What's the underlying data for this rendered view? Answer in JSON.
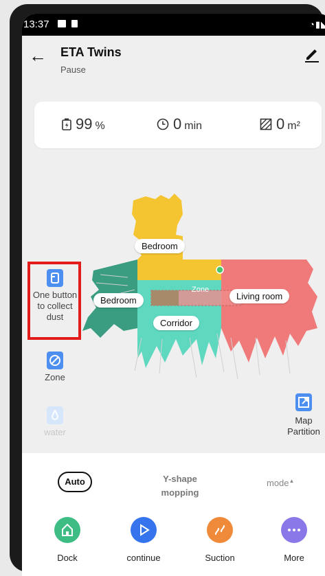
{
  "status_bar": {
    "time": "13:37"
  },
  "header": {
    "title": "ETA Twins",
    "subtitle": "Pause"
  },
  "stats": {
    "battery": {
      "value": "99",
      "unit": "%"
    },
    "time": {
      "value": "0",
      "unit": "min"
    },
    "area": {
      "value": "0",
      "unit": "m²"
    }
  },
  "map": {
    "labels": {
      "bedroom_top": "Bedroom",
      "bedroom_left": "Bedroom",
      "zone": "Zone",
      "living_room": "Living room",
      "corridor": "Corridor"
    },
    "colors": {
      "yellow": "#f5c431",
      "teal": "#3a9c80",
      "mint": "#5fd8c0",
      "coral": "#f07a7a",
      "zone_box": "#a78a6a"
    }
  },
  "side_actions": {
    "collect_dust": "One button to collect dust",
    "zone": "Zone",
    "water": "water"
  },
  "map_partition": "Map Partition",
  "modes": {
    "auto": "Auto",
    "yshape": "Y-shape mopping",
    "mode": "mode"
  },
  "actions": {
    "dock": {
      "label": "Dock",
      "color": "#3dbd84"
    },
    "continue": {
      "label": "continue",
      "color": "#3574ec"
    },
    "suction": {
      "label": "Suction",
      "color": "#ef8a3a"
    },
    "more": {
      "label": "More",
      "color": "#8b78e8"
    }
  }
}
